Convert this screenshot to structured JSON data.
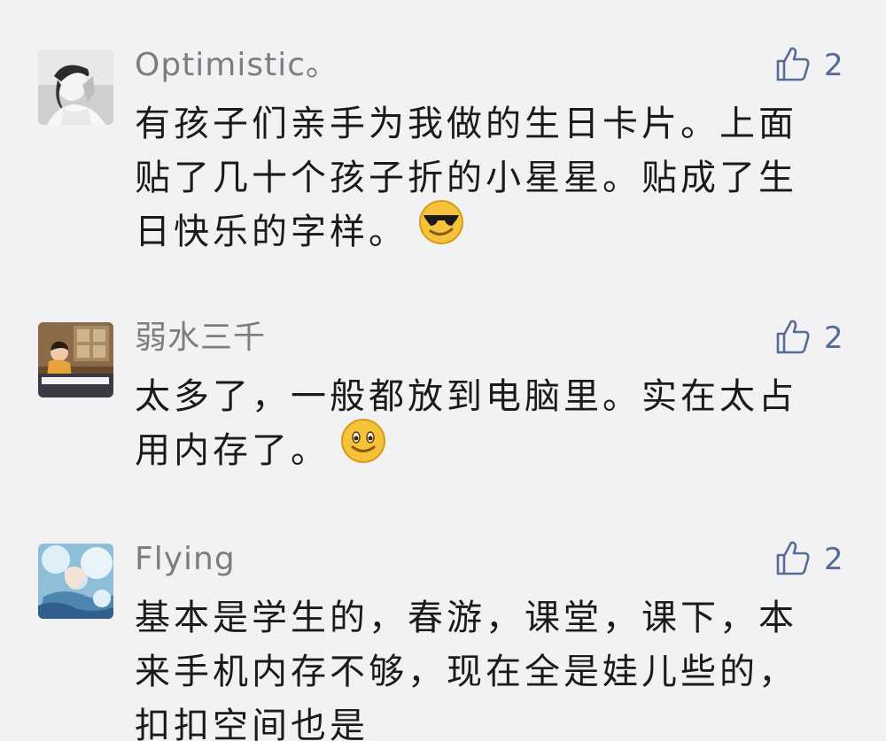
{
  "comments": [
    {
      "author": "Optimistic。",
      "likes": "2",
      "text": "有孩子们亲手为我做的生日卡片。上面贴了几十个孩子折的小星星。贴成了生日快乐的字样。",
      "emoji": "cool-sunglasses-emoji"
    },
    {
      "author": "弱水三千",
      "likes": "2",
      "text": "太多了，一般都放到电脑里。实在太占用内存了。",
      "emoji": "smile-emoji"
    },
    {
      "author": "Flying",
      "likes": "2",
      "text": "基本是学生的，春游，课堂，课下，本来手机内存不够，现在全是娃儿些的，扣扣空间也是",
      "emoji": ""
    }
  ],
  "colors": {
    "background": "#f2f2f4",
    "author": "#7d7d80",
    "like": "#576b95",
    "text": "#1a1a1a"
  },
  "icons": {
    "like": "thumbs-up-icon"
  }
}
